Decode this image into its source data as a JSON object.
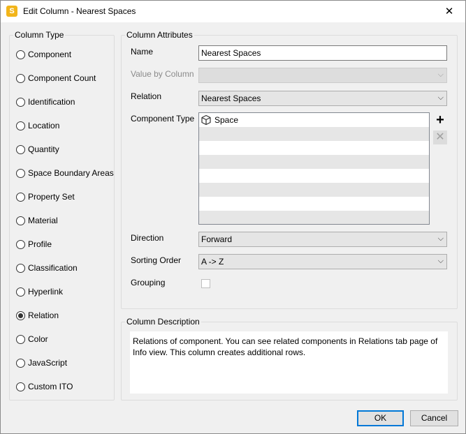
{
  "window": {
    "title": "Edit Column - Nearest Spaces",
    "app_icon_letter": "S",
    "close_glyph": "✕"
  },
  "column_type": {
    "legend": "Column Type",
    "options": [
      {
        "label": "Component",
        "checked": false
      },
      {
        "label": "Component Count",
        "checked": false
      },
      {
        "label": "Identification",
        "checked": false
      },
      {
        "label": "Location",
        "checked": false
      },
      {
        "label": "Quantity",
        "checked": false
      },
      {
        "label": "Space Boundary Areas",
        "checked": false
      },
      {
        "label": "Property Set",
        "checked": false
      },
      {
        "label": "Material",
        "checked": false
      },
      {
        "label": "Profile",
        "checked": false
      },
      {
        "label": "Classification",
        "checked": false
      },
      {
        "label": "Hyperlink",
        "checked": false
      },
      {
        "label": "Relation",
        "checked": true
      },
      {
        "label": "Color",
        "checked": false
      },
      {
        "label": "JavaScript",
        "checked": false
      },
      {
        "label": "Custom ITO",
        "checked": false
      }
    ]
  },
  "attributes": {
    "legend": "Column Attributes",
    "name_label": "Name",
    "name_value": "Nearest Spaces",
    "value_by_column_label": "Value by Column",
    "value_by_column_value": "",
    "relation_label": "Relation",
    "relation_value": "Nearest Spaces",
    "component_type_label": "Component Type",
    "component_types": [
      {
        "label": "Space",
        "icon": "cube-icon"
      },
      {
        "label": ""
      },
      {
        "label": ""
      },
      {
        "label": ""
      },
      {
        "label": ""
      },
      {
        "label": ""
      },
      {
        "label": ""
      },
      {
        "label": ""
      }
    ],
    "add_glyph": "+",
    "remove_glyph": "✕",
    "direction_label": "Direction",
    "direction_value": "Forward",
    "sorting_label": "Sorting Order",
    "sorting_value": "A -> Z",
    "grouping_label": "Grouping",
    "grouping_checked": false,
    "combo_arrow": "⌵"
  },
  "description": {
    "legend": "Column Description",
    "text": "Relations of component. You can see related components in Relations tab page of Info view. This column creates additional rows."
  },
  "buttons": {
    "ok": "OK",
    "cancel": "Cancel"
  }
}
